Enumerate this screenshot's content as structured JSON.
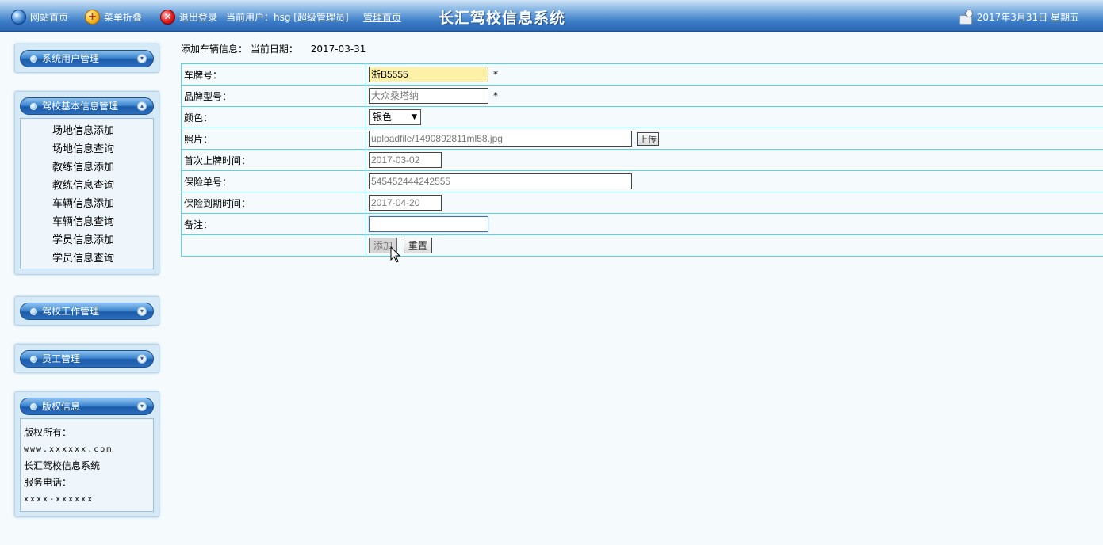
{
  "topbar": {
    "home": "网站首页",
    "menu_toggle": "菜单折叠",
    "logout": "退出登录",
    "current_user": "当前用户：hsg [超级管理员]",
    "admin_home": "管理首页",
    "system_title": "长汇驾校信息系统",
    "date": "2017年3月31日 星期五"
  },
  "sidebar": {
    "panels": [
      {
        "title": "系统用户管理",
        "chevron": "▾"
      },
      {
        "title": "驾校基本信息管理",
        "chevron": "▴",
        "items": [
          "场地信息添加",
          "场地信息查询",
          "教练信息添加",
          "教练信息查询",
          "车辆信息添加",
          "车辆信息查询",
          "学员信息添加",
          "学员信息查询"
        ]
      },
      {
        "title": "驾校工作管理",
        "chevron": "▾"
      },
      {
        "title": "员工管理",
        "chevron": "▾"
      },
      {
        "title": "版权信息",
        "chevron": "▾",
        "lines": [
          "版权所有：",
          "www.xxxxxx.com",
          "长汇驾校信息系统",
          "服务电话：",
          "xxxx-xxxxxx"
        ]
      }
    ]
  },
  "main": {
    "heading": "添加车辆信息：",
    "date_label": "当前日期：",
    "date_value": "2017-03-31",
    "form": {
      "plate_label": "车牌号：",
      "plate_value": "浙B5555",
      "model_label": "品牌型号：",
      "model_value": "大众桑塔纳",
      "color_label": "颜色：",
      "color_value": "银色",
      "photo_label": "照片：",
      "photo_value": "uploadfile/1490892811ml58.jpg",
      "upload_label": "上传",
      "first_reg_label": "首次上牌时间：",
      "first_reg_value": "2017-03-02",
      "insurance_no_label": "保险单号：",
      "insurance_no_value": "545452444242555",
      "insurance_exp_label": "保险到期时间：",
      "insurance_exp_value": "2017-04-20",
      "remark_label": "备注：",
      "remark_value": "",
      "required_mark": "*",
      "add_button": "添加",
      "reset_button": "重置"
    }
  }
}
